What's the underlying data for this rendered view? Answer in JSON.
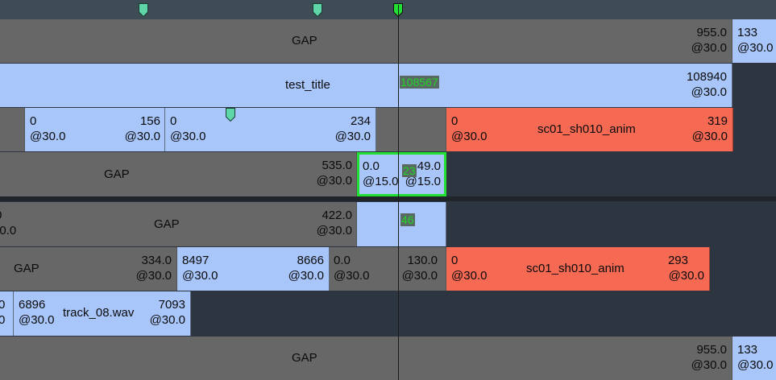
{
  "timeline": {
    "markers": [
      {
        "color": "#5fd6a8"
      },
      {
        "color": "#5fd6a8"
      },
      {
        "color": "#22e033",
        "current": true
      }
    ],
    "tracks": [
      {
        "clips": [
          {
            "kind": "gap",
            "name": "GAP"
          },
          {
            "kind": "gap",
            "end": "955.0",
            "end_rate": "@30.0"
          },
          {
            "kind": "media",
            "start": "133",
            "start_rate": "@30.0"
          }
        ]
      },
      {
        "clips": [
          {
            "kind": "media",
            "name": "test_title",
            "frame_badge": "108567",
            "end": "108940",
            "end_rate": "@30.0"
          }
        ]
      },
      {
        "clips": [
          {
            "kind": "gap"
          },
          {
            "kind": "media",
            "start": "0",
            "start_rate": "@30.0",
            "end": "156",
            "end_rate": "@30.0"
          },
          {
            "kind": "media",
            "start": "0",
            "start_rate": "@30.0",
            "end": "234",
            "end_rate": "@30.0"
          },
          {
            "kind": "gap"
          },
          {
            "kind": "red",
            "name": "sc01_sh010_anim",
            "start": "0",
            "start_rate": "@30.0",
            "end": "319",
            "end_rate": "@30.0"
          }
        ]
      },
      {
        "clips": [
          {
            "kind": "gap",
            "name": "GAP",
            "end": "535.0",
            "end_rate": "@30.0"
          },
          {
            "kind": "media",
            "selected": true,
            "start": "0.0",
            "start_rate": "@15.0",
            "end": "49.0",
            "end_rate": "@15.0",
            "frame_badge": "23"
          }
        ]
      },
      {
        "clips": [
          {
            "kind": "gap",
            "name": "GAP",
            "start": "0",
            "start_rate": "30.0",
            "end": "422.0",
            "end_rate": "@30.0"
          },
          {
            "kind": "media",
            "frame_badge": "46"
          }
        ]
      },
      {
        "clips": [
          {
            "kind": "gap",
            "name": "GAP",
            "end": "334.0",
            "end_rate": "@30.0"
          },
          {
            "kind": "media",
            "start": "8497",
            "start_rate": "@30.0",
            "end": "8666",
            "end_rate": "@30.0"
          },
          {
            "kind": "gap",
            "start": "0.0",
            "start_rate": "@30.0",
            "end": "130.0",
            "end_rate": "@30.0"
          },
          {
            "kind": "red",
            "name": "sc01_sh010_anim",
            "start": "0",
            "start_rate": "@30.0",
            "end": "293",
            "end_rate": "@30.0"
          }
        ]
      },
      {
        "clips": [
          {
            "kind": "media",
            "start": "0",
            "start_rate": "0"
          },
          {
            "kind": "media",
            "name": "track_08.wav",
            "start": "6896",
            "start_rate": "@30.0",
            "end": "7093",
            "end_rate": "@30.0"
          }
        ]
      },
      {
        "clips": [
          {
            "kind": "gap",
            "name": "GAP"
          },
          {
            "kind": "gap",
            "end": "955.0",
            "end_rate": "@30.0"
          },
          {
            "kind": "media",
            "start": "133",
            "start_rate": "@30.0"
          }
        ]
      }
    ]
  },
  "colors": {
    "gap": "#676767",
    "media": "#a9c6fb",
    "red_clip": "#f66953",
    "selection": "#22e033",
    "background": "#2d3540",
    "ruler": "#3e4c56"
  }
}
